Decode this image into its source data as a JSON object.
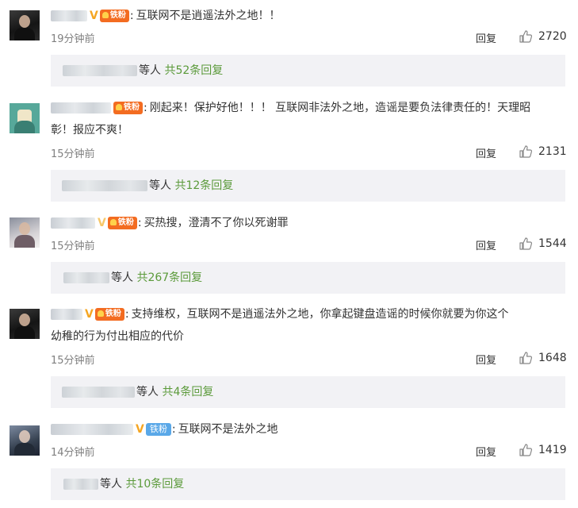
{
  "comments": [
    {
      "text": "互联网不是逍遥法外之地！！",
      "time": "19分钟前",
      "reply": "回复",
      "likes": "2720",
      "replies": {
        "who": "等人",
        "total": "共52条回复"
      }
    },
    {
      "text_line1": "刚起来！保护好他！！！ 互联网非法外之地，造谣是要负法律责任的！天理昭",
      "text_line2": "彰！报应不爽！",
      "time": "15分钟前",
      "reply": "回复",
      "likes": "2131",
      "replies": {
        "who": "等人",
        "total": "共12条回复"
      }
    },
    {
      "text": "买热搜，澄清不了你以死谢罪",
      "time": "15分钟前",
      "reply": "回复",
      "likes": "1544",
      "replies": {
        "who": "等人",
        "total": "共267条回复"
      }
    },
    {
      "text_line1": "支持维权，互联网不是逍遥法外之地，你拿起键盘造谣的时候你就要为你这个",
      "text_line2": "幼稚的行为付出相应的代价",
      "time": "15分钟前",
      "reply": "回复",
      "likes": "1648",
      "replies": {
        "who": "等人",
        "total": "共4条回复"
      }
    },
    {
      "text": "互联网不是法外之地",
      "time": "14分钟前",
      "reply": "回复",
      "likes": "1419",
      "fan_label": "铁粉",
      "replies": {
        "who": "等人",
        "total": "共10条回复"
      }
    }
  ],
  "fan_badge_label": "铁粉",
  "icons": {
    "like": "thumbs-up-icon",
    "verified": "verified-v-icon",
    "fan": "crown-icon"
  },
  "colors": {
    "reply_total": "#5b9a3a",
    "fan_badge": "#f36c21",
    "fan_badge_blue": "#5aa8e8",
    "reply_bar": "#f2f2f5"
  }
}
